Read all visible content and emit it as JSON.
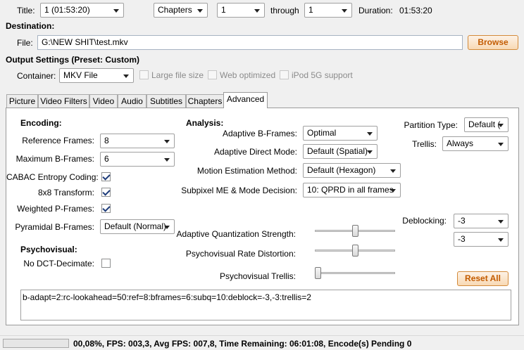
{
  "source": {
    "title_label": "Title:",
    "title_value": "1 (01:53:20)",
    "mode_value": "Chapters",
    "from_value": "1",
    "through_label": "through",
    "to_value": "1",
    "duration_label": "Duration:",
    "duration_value": "01:53:20"
  },
  "destination": {
    "heading": "Destination:",
    "file_label": "File:",
    "file_value": "G:\\NEW SHIT\\test.mkv",
    "browse_label": "Browse"
  },
  "output": {
    "heading": "Output Settings (Preset: Custom)",
    "container_label": "Container:",
    "container_value": "MKV File",
    "large_file_label": "Large file size",
    "web_optimized_label": "Web optimized",
    "ipod_label": "iPod 5G support"
  },
  "tabs": [
    {
      "label": "Picture"
    },
    {
      "label": "Video Filters"
    },
    {
      "label": "Video"
    },
    {
      "label": "Audio"
    },
    {
      "label": "Subtitles"
    },
    {
      "label": "Chapters"
    },
    {
      "label": "Advanced"
    }
  ],
  "encoding": {
    "heading": "Encoding:",
    "ref_frames_label": "Reference Frames:",
    "ref_frames_value": "8",
    "max_b_label": "Maximum B-Frames:",
    "max_b_value": "6",
    "cabac_label": "CABAC Entropy Coding:",
    "cabac_checked": true,
    "transform_label": "8x8 Transform:",
    "transform_checked": true,
    "weighted_p_label": "Weighted P-Frames:",
    "weighted_p_checked": true,
    "pyramidal_label": "Pyramidal B-Frames:",
    "pyramidal_value": "Default (Normal)"
  },
  "psychovisual": {
    "heading": "Psychovisual:",
    "no_dct_label": "No DCT-Decimate:",
    "no_dct_checked": false
  },
  "analysis": {
    "heading": "Analysis:",
    "adaptive_b_label": "Adaptive B-Frames:",
    "adaptive_b_value": "Optimal",
    "adaptive_direct_label": "Adaptive Direct Mode:",
    "adaptive_direct_value": "Default (Spatial)",
    "motion_label": "Motion Estimation Method:",
    "motion_value": "Default (Hexagon)",
    "subpixel_label": "Subpixel ME & Mode Decision:",
    "subpixel_value": "10: QPRD in all frames",
    "partition_label": "Partition Type:",
    "partition_value": "Default (",
    "trellis_label": "Trellis:",
    "trellis_value": "Always",
    "deblocking_label": "Deblocking:",
    "deblock_1": "-3",
    "deblock_2": "-3",
    "aq_label": "Adaptive Quantization Strength:",
    "aq_level": 0.5,
    "psy_rd_label": "Psychovisual Rate Distortion:",
    "psy_rd_level": 0.5,
    "psy_trellis_label": "Psychovisual Trellis:",
    "psy_trellis_level": 0.0,
    "reset_label": "Reset All"
  },
  "options_string": "b-adapt=2:rc-lookahead=50:ref=8:bframes=6:subq=10:deblock=-3,-3:trellis=2",
  "status": {
    "text": "00,08%,  FPS: 003,3,  Avg FPS: 007,8,  Time Remaining: 06:01:08,  Encode(s) Pending 0",
    "progress": 0.0008
  },
  "colors": {
    "accent_button_text": "#c35b00",
    "check_mark": "#1e3c7a"
  }
}
